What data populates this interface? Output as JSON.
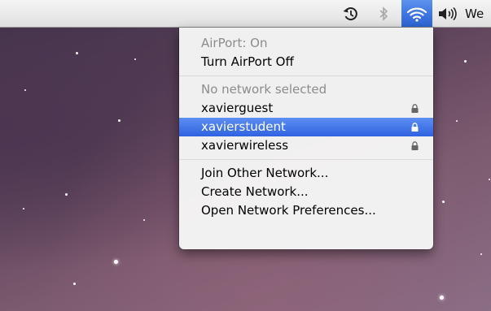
{
  "menubar": {
    "clock_text": "We",
    "icons": [
      "time-machine-icon",
      "bluetooth-icon",
      "wifi-icon",
      "volume-icon"
    ]
  },
  "menu": {
    "airport_status": "AirPort: On",
    "toggle_label": "Turn AirPort Off",
    "no_network_label": "No network selected",
    "networks": [
      {
        "name": "xavierguest",
        "locked": true,
        "selected": false
      },
      {
        "name": "xavierstudent",
        "locked": true,
        "selected": true
      },
      {
        "name": "xavierwireless",
        "locked": true,
        "selected": false
      }
    ],
    "join_other_label": "Join Other Network...",
    "create_network_label": "Create Network...",
    "open_prefs_label": "Open Network Preferences..."
  },
  "colors": {
    "selection_blue": "#3d74e0",
    "menu_background": "#f6f6f6",
    "menubar_background": "#e9e9e9"
  }
}
